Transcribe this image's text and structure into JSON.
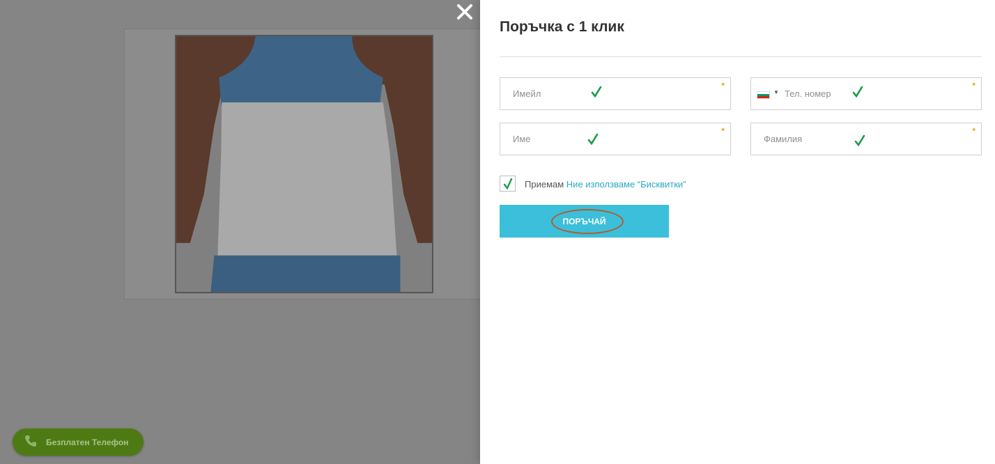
{
  "backdrop": {
    "product_image": "product-photo",
    "call_button": {
      "label": "Безплатен Телефон",
      "icon": "phone-icon"
    }
  },
  "panel": {
    "title": "Поръчка с 1 клик",
    "close_icon": "close-icon",
    "fields": {
      "email": {
        "placeholder": "Имейл",
        "required_mark": "*",
        "valid": true
      },
      "phone": {
        "placeholder": "Тел. номер",
        "required_mark": "*",
        "valid": true,
        "country_flag": "bg-flag-icon"
      },
      "first_name": {
        "placeholder": "Име",
        "required_mark": "*",
        "valid": true
      },
      "last_name": {
        "placeholder": "Фамилия",
        "required_mark": "*",
        "valid": true
      }
    },
    "agreement": {
      "checked": true,
      "prefix": "Приемам",
      "link_text": "Ние използваме “Бисквитки”"
    },
    "submit_label": "ПОРЪЧАЙ"
  },
  "colors": {
    "accent": "#3bbfda",
    "check_green": "#1a9a4a",
    "required_orange": "#f39c12",
    "call_pill": "#4e7a14"
  }
}
